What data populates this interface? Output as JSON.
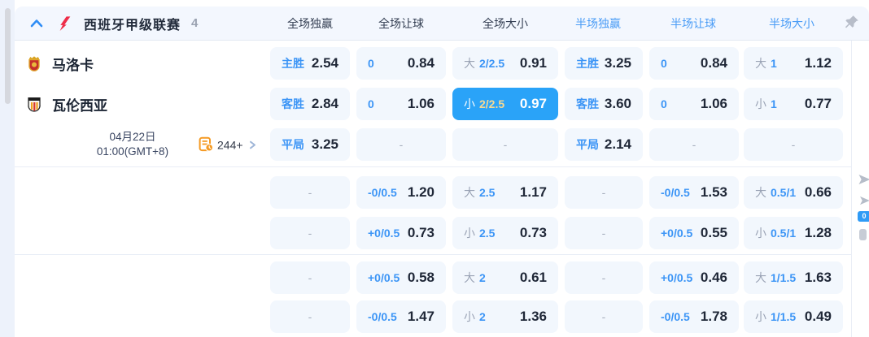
{
  "header": {
    "league_name": "西班牙甲级联赛",
    "match_count": "4",
    "columns": [
      "全场独赢",
      "全场让球",
      "全场大小",
      "半场独赢",
      "半场让球",
      "半场大小"
    ]
  },
  "match": {
    "home_team": "马洛卡",
    "away_team": "瓦伦西亚",
    "date": "04月22日",
    "time": "01:00(GMT+8)",
    "more_markets": "244+"
  },
  "odds": {
    "empty_placeholder": "-",
    "groups": [
      [
        [
          {
            "type": "result",
            "label": "主胜",
            "odds": "2.54"
          },
          {
            "type": "handicap",
            "label": "0",
            "odds": "0.84"
          },
          {
            "type": "over-under",
            "side": "大",
            "line": "2/2.5",
            "odds": "0.91"
          },
          {
            "type": "result",
            "label": "主胜",
            "odds": "3.25"
          },
          {
            "type": "handicap",
            "label": "0",
            "odds": "0.84"
          },
          {
            "type": "over-under",
            "side": "大",
            "line": "1",
            "odds": "1.12"
          }
        ],
        [
          {
            "type": "result",
            "label": "客胜",
            "odds": "2.84"
          },
          {
            "type": "handicap",
            "label": "0",
            "odds": "1.06"
          },
          {
            "type": "over-under",
            "side": "小",
            "line": "2/2.5",
            "odds": "0.97",
            "selected": true
          },
          {
            "type": "result",
            "label": "客胜",
            "odds": "3.60"
          },
          {
            "type": "handicap",
            "label": "0",
            "odds": "1.06"
          },
          {
            "type": "over-under",
            "side": "小",
            "line": "1",
            "odds": "0.77"
          }
        ],
        [
          {
            "type": "result",
            "label": "平局",
            "odds": "3.25"
          },
          {
            "type": "empty"
          },
          {
            "type": "empty"
          },
          {
            "type": "result",
            "label": "平局",
            "odds": "2.14"
          },
          {
            "type": "empty"
          },
          {
            "type": "empty"
          }
        ]
      ],
      [
        [
          {
            "type": "empty"
          },
          {
            "type": "handicap",
            "label": "-0/0.5",
            "odds": "1.20"
          },
          {
            "type": "over-under",
            "side": "大",
            "line": "2.5",
            "odds": "1.17"
          },
          {
            "type": "empty"
          },
          {
            "type": "handicap",
            "label": "-0/0.5",
            "odds": "1.53"
          },
          {
            "type": "over-under",
            "side": "大",
            "line": "0.5/1",
            "odds": "0.66"
          }
        ],
        [
          {
            "type": "empty"
          },
          {
            "type": "handicap",
            "label": "+0/0.5",
            "odds": "0.73"
          },
          {
            "type": "over-under",
            "side": "小",
            "line": "2.5",
            "odds": "0.73"
          },
          {
            "type": "empty"
          },
          {
            "type": "handicap",
            "label": "+0/0.5",
            "odds": "0.55"
          },
          {
            "type": "over-under",
            "side": "小",
            "line": "0.5/1",
            "odds": "1.28"
          }
        ]
      ],
      [
        [
          {
            "type": "empty"
          },
          {
            "type": "handicap",
            "label": "+0/0.5",
            "odds": "0.58"
          },
          {
            "type": "over-under",
            "side": "大",
            "line": "2",
            "odds": "0.61"
          },
          {
            "type": "empty"
          },
          {
            "type": "handicap",
            "label": "+0/0.5",
            "odds": "0.46"
          },
          {
            "type": "over-under",
            "side": "大",
            "line": "1/1.5",
            "odds": "1.63"
          }
        ],
        [
          {
            "type": "empty"
          },
          {
            "type": "handicap",
            "label": "-0/0.5",
            "odds": "1.47"
          },
          {
            "type": "over-under",
            "side": "小",
            "line": "2",
            "odds": "1.36"
          },
          {
            "type": "empty"
          },
          {
            "type": "handicap",
            "label": "-0/0.5",
            "odds": "1.78"
          },
          {
            "type": "over-under",
            "side": "小",
            "line": "1/1.5",
            "odds": "0.49"
          }
        ]
      ]
    ]
  },
  "icons": {
    "collapse": "chevron-up",
    "league_logo": "laliga-mark",
    "home_crest": "mallorca-crest",
    "away_crest": "valencia-crest",
    "more_markets": "odds-sheet-clock",
    "expand": "chevron-right",
    "pin": "pushpin"
  },
  "colors": {
    "accent_blue": "#3c95f6",
    "header_link_blue": "#4a9cf6",
    "selected_bg": "#2aa3f8",
    "selected_line_gold": "#f6d993",
    "label_gray": "#9aa3b5",
    "value_dark": "#1f2737",
    "brand_red": "#ee2d49",
    "markets_orange": "#f59a23",
    "cell_bg": "#f2f7fd",
    "header_bg": "#f3f7fe"
  }
}
